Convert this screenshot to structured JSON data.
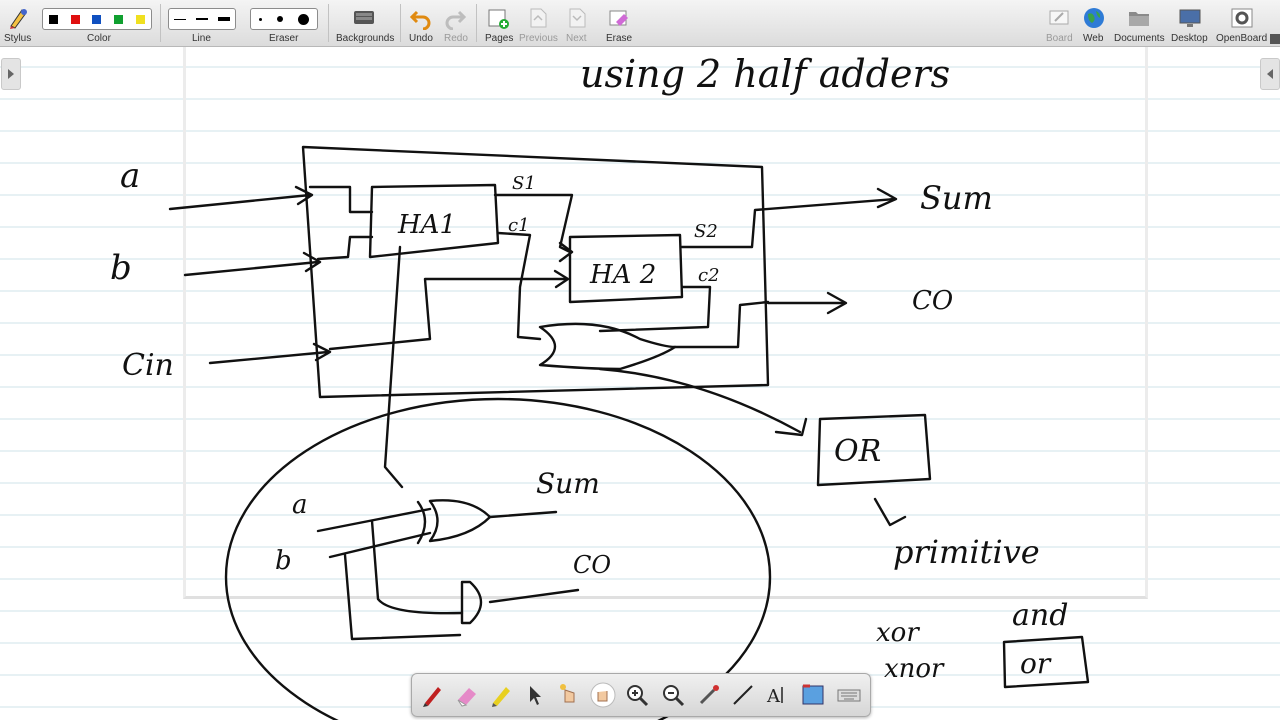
{
  "toolbar": {
    "stylus_label": "Stylus",
    "color_label": "Color",
    "line_label": "Line",
    "eraser_label": "Eraser",
    "backgrounds_label": "Backgrounds",
    "undo_label": "Undo",
    "redo_label": "Redo",
    "pages_label": "Pages",
    "previous_label": "Previous",
    "next_label": "Next",
    "erase_label": "Erase",
    "board_label": "Board",
    "web_label": "Web",
    "documents_label": "Documents",
    "desktop_label": "Desktop",
    "openboard_label": "OpenBoard",
    "colors": [
      "#000000",
      "#e01010",
      "#1050c0",
      "#10a030",
      "#f0e020"
    ]
  },
  "colors": {
    "ink": "#111111",
    "ruled_line": "#cfe3ea",
    "toolbar_bg": "#e4e4e4"
  },
  "board": {
    "handwriting": {
      "title": "using 2 half adders",
      "input_a": "a",
      "input_b": "b",
      "input_cin": "Cin",
      "ha1": "HA1",
      "ha2": "HA 2",
      "s1": "S1",
      "c1": "c1",
      "s2": "S2",
      "c2": "c2",
      "out_sum": "Sum",
      "out_co": "CO",
      "or_box": "OR",
      "primitive": "primitive",
      "gate_a": "a",
      "gate_b": "b",
      "gate_sum": "Sum",
      "gate_co": "CO",
      "xor": "xor",
      "and": "and",
      "xnor": "xnor",
      "or": "or"
    }
  },
  "bottom_toolbar": {
    "tools": [
      "pen-icon",
      "eraser-icon",
      "highlighter-icon",
      "pointer-icon",
      "laser-hand-icon",
      "hand-icon",
      "zoom-in-icon",
      "zoom-out-icon",
      "laser-pointer-icon",
      "line-icon",
      "text-icon",
      "capture-icon",
      "keyboard-icon"
    ]
  }
}
